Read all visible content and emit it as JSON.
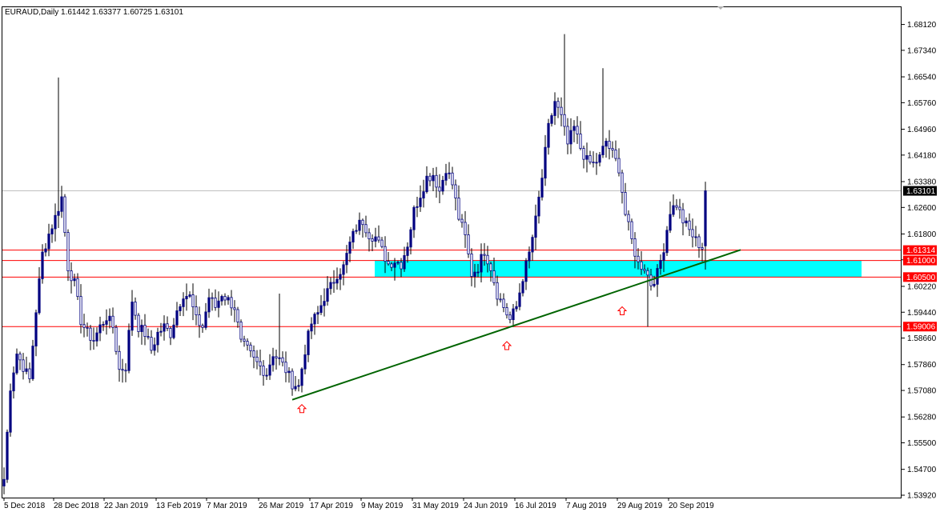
{
  "symbol_header": "EURAUD,Daily  1.61442 1.63377 1.60725 1.63101",
  "colors": {
    "bull_candle": "#000080",
    "bear_candle": "#000080",
    "wick": "#000000",
    "current_price_line": "#c0c0c0",
    "current_price_tag_bg": "#000000",
    "current_price_tag_text": "#ffffff",
    "level_line": "#ff0000",
    "level_tag_bg": "#ff0000",
    "level_tag_text": "#ffffff",
    "zone_fill": "#00ffff",
    "trendline": "#006400",
    "arrow": "#ff0000"
  },
  "chart_data": {
    "type": "candlestick",
    "ylim": [
      1.5392,
      1.6852
    ],
    "y_ticks": [
      "1.68120",
      "1.67340",
      "1.66540",
      "1.65760",
      "1.64960",
      "1.64180",
      "1.63380",
      "1.62600",
      "1.61800",
      "1.61020",
      "1.60220",
      "1.59440",
      "1.58660",
      "1.57860",
      "1.57080",
      "1.56280",
      "1.55500",
      "1.54700",
      "1.53920"
    ],
    "x_labels": [
      "5 Dec 2018",
      "28 Dec 2018",
      "22 Jan 2019",
      "13 Feb 2019",
      "7 Mar 2019",
      "26 Mar 2019",
      "17 Apr 2019",
      "9 May 2019",
      "31 May 2019",
      "24 Jun 2019",
      "16 Jul 2019",
      "7 Aug 2019",
      "29 Aug 2019",
      "20 Sep 2019"
    ],
    "current_price": {
      "label": "1.63101",
      "value": 1.63101
    },
    "levels": [
      {
        "label": "1.61314",
        "value": 1.61314
      },
      {
        "label": "1.61000",
        "value": 1.61
      },
      {
        "label": "1.60500",
        "value": 1.605
      },
      {
        "label": "1.59006",
        "value": 1.59006
      }
    ],
    "zone": {
      "top": 1.61,
      "bottom": 1.605
    },
    "trendline": {
      "start": {
        "bar": 90,
        "price": 1.568
      },
      "end": {
        "bar": 230,
        "price": 1.6132
      }
    },
    "arrows": [
      {
        "bar": 93,
        "price": 1.5675
      },
      {
        "bar": 157,
        "price": 1.5865
      },
      {
        "bar": 193,
        "price": 1.597
      }
    ],
    "anchors": [
      [
        0,
        1.544
      ],
      [
        2,
        1.572
      ],
      [
        4,
        1.582
      ],
      [
        6,
        1.578
      ],
      [
        8,
        1.574
      ],
      [
        10,
        1.595
      ],
      [
        12,
        1.612
      ],
      [
        14,
        1.618
      ],
      [
        16,
        1.623
      ],
      [
        18,
        1.629
      ],
      [
        20,
        1.608
      ],
      [
        22,
        1.603
      ],
      [
        24,
        1.592
      ],
      [
        26,
        1.588
      ],
      [
        28,
        1.586
      ],
      [
        30,
        1.59
      ],
      [
        32,
        1.593
      ],
      [
        34,
        1.59
      ],
      [
        36,
        1.577
      ],
      [
        38,
        1.578
      ],
      [
        40,
        1.598
      ],
      [
        42,
        1.59
      ],
      [
        44,
        1.588
      ],
      [
        46,
        1.583
      ],
      [
        48,
        1.588
      ],
      [
        50,
        1.59
      ],
      [
        52,
        1.588
      ],
      [
        54,
        1.595
      ],
      [
        56,
        1.6
      ],
      [
        58,
        1.599
      ],
      [
        60,
        1.592
      ],
      [
        62,
        1.59
      ],
      [
        64,
        1.599
      ],
      [
        66,
        1.596
      ],
      [
        68,
        1.6
      ],
      [
        70,
        1.598
      ],
      [
        72,
        1.596
      ],
      [
        74,
        1.585
      ],
      [
        76,
        1.583
      ],
      [
        78,
        1.58
      ],
      [
        80,
        1.578
      ],
      [
        82,
        1.576
      ],
      [
        84,
        1.582
      ],
      [
        86,
        1.58
      ],
      [
        88,
        1.577
      ],
      [
        90,
        1.573
      ],
      [
        92,
        1.572
      ],
      [
        94,
        1.583
      ],
      [
        96,
        1.591
      ],
      [
        98,
        1.594
      ],
      [
        100,
        1.599
      ],
      [
        102,
        1.602
      ],
      [
        104,
        1.606
      ],
      [
        106,
        1.608
      ],
      [
        108,
        1.615
      ],
      [
        110,
        1.62
      ],
      [
        112,
        1.622
      ],
      [
        114,
        1.618
      ],
      [
        116,
        1.617
      ],
      [
        118,
        1.613
      ],
      [
        120,
        1.609
      ],
      [
        122,
        1.61
      ],
      [
        124,
        1.609
      ],
      [
        126,
        1.615
      ],
      [
        128,
        1.625
      ],
      [
        130,
        1.63
      ],
      [
        132,
        1.635
      ],
      [
        134,
        1.636
      ],
      [
        136,
        1.631
      ],
      [
        138,
        1.638
      ],
      [
        140,
        1.633
      ],
      [
        142,
        1.623
      ],
      [
        144,
        1.617
      ],
      [
        146,
        1.606
      ],
      [
        148,
        1.608
      ],
      [
        150,
        1.613
      ],
      [
        152,
        1.608
      ],
      [
        154,
        1.6
      ],
      [
        156,
        1.596
      ],
      [
        158,
        1.592
      ],
      [
        160,
        1.596
      ],
      [
        162,
        1.605
      ],
      [
        164,
        1.612
      ],
      [
        166,
        1.622
      ],
      [
        168,
        1.635
      ],
      [
        170,
        1.65
      ],
      [
        172,
        1.658
      ],
      [
        174,
        1.653
      ],
      [
        176,
        1.645
      ],
      [
        178,
        1.65
      ],
      [
        180,
        1.644
      ],
      [
        182,
        1.64
      ],
      [
        184,
        1.639
      ],
      [
        186,
        1.641
      ],
      [
        188,
        1.646
      ],
      [
        190,
        1.642
      ],
      [
        192,
        1.638
      ],
      [
        194,
        1.624
      ],
      [
        196,
        1.616
      ],
      [
        198,
        1.609
      ],
      [
        200,
        1.608
      ],
      [
        202,
        1.603
      ],
      [
        204,
        1.606
      ],
      [
        206,
        1.614
      ],
      [
        208,
        1.625
      ],
      [
        210,
        1.627
      ],
      [
        212,
        1.622
      ],
      [
        214,
        1.619
      ],
      [
        216,
        1.616
      ],
      [
        218,
        1.614
      ],
      [
        219,
        1.631
      ]
    ],
    "spikes": [
      {
        "bar": 17,
        "high": 1.6652
      },
      {
        "bar": 86,
        "high": 1.6
      },
      {
        "bar": 175,
        "high": 1.6783
      },
      {
        "bar": 187,
        "high": 1.668
      },
      {
        "bar": 201,
        "low": 1.59
      },
      {
        "bar": 219,
        "high": 1.63377,
        "low": 1.60725
      }
    ]
  }
}
